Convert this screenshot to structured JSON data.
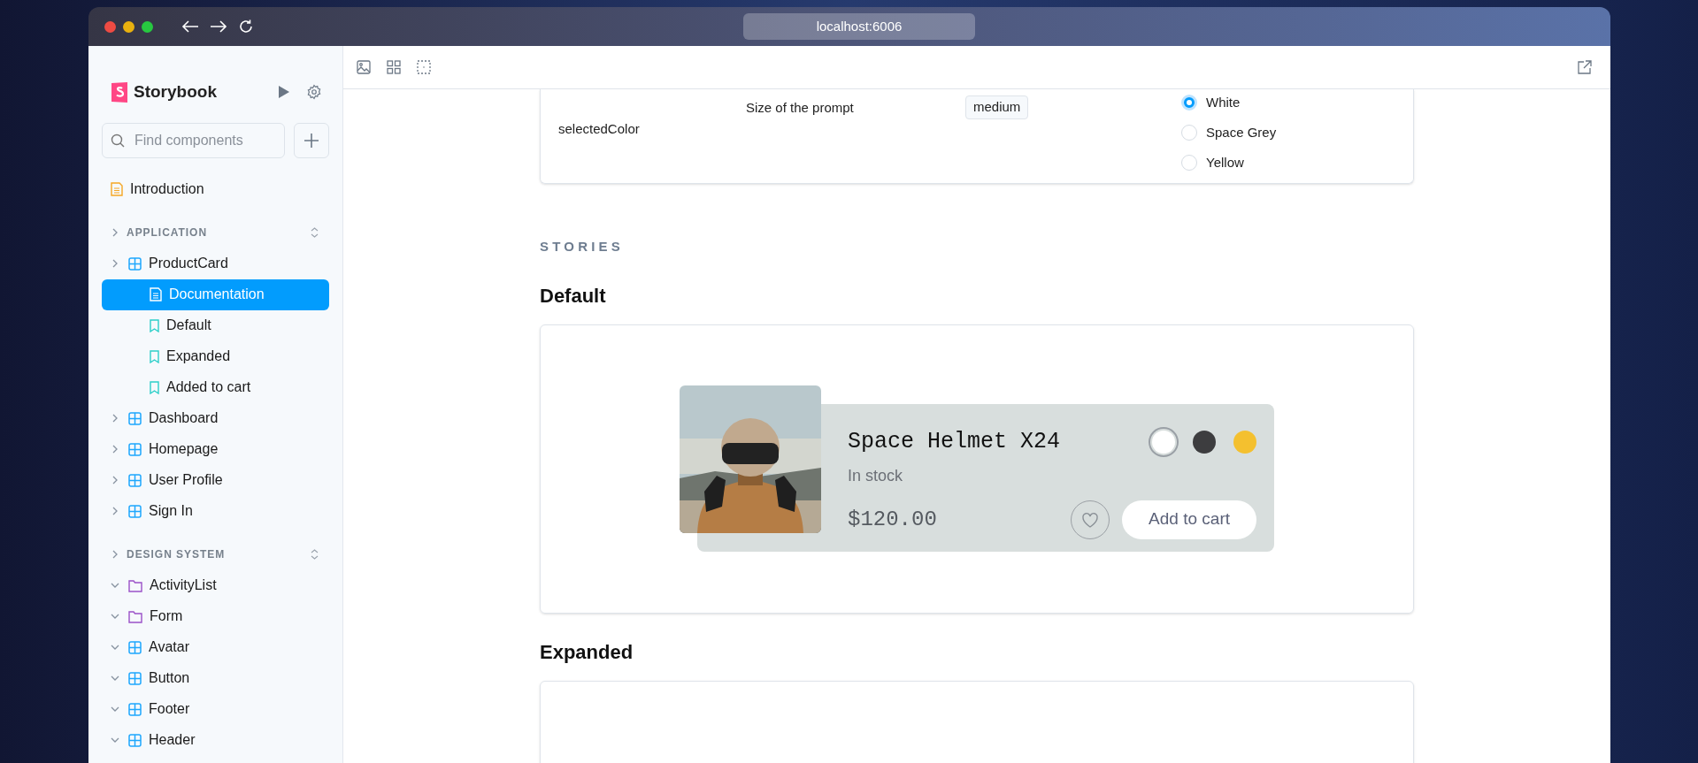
{
  "browser": {
    "address": "localhost:6006"
  },
  "sidebar": {
    "title": "Storybook",
    "search": {
      "placeholder": "Find components"
    },
    "items": [
      {
        "kind": "docs",
        "label": "Introduction",
        "selected": false
      },
      {
        "kind": "section",
        "label": "APPLICATION",
        "expanded": false,
        "children": [
          {
            "kind": "component",
            "label": "ProductCard",
            "expanded": false,
            "selected": false,
            "children": [
              {
                "kind": "page",
                "label": "Documentation",
                "selected": true
              },
              {
                "kind": "story",
                "label": "Default",
                "selected": false
              },
              {
                "kind": "story",
                "label": "Expanded",
                "selected": false
              },
              {
                "kind": "story",
                "label": "Added to cart",
                "selected": false
              }
            ]
          },
          {
            "kind": "component",
            "label": "Dashboard",
            "expanded": false,
            "selected": false
          },
          {
            "kind": "component",
            "label": "Homepage",
            "expanded": false,
            "selected": false
          },
          {
            "kind": "component",
            "label": "User Profile",
            "expanded": false,
            "selected": false
          },
          {
            "kind": "component",
            "label": "Sign In",
            "expanded": false,
            "selected": false
          }
        ]
      },
      {
        "kind": "section",
        "label": "DESIGN SYSTEM",
        "expanded": false,
        "children": [
          {
            "kind": "folder",
            "label": "ActivityList",
            "expanded": true,
            "selected": false
          },
          {
            "kind": "folder",
            "label": "Form",
            "expanded": true,
            "selected": false
          },
          {
            "kind": "component",
            "label": "Avatar",
            "expanded": true,
            "selected": false
          },
          {
            "kind": "component",
            "label": "Button",
            "expanded": true,
            "selected": false
          },
          {
            "kind": "component",
            "label": "Footer",
            "expanded": true,
            "selected": false
          },
          {
            "kind": "component",
            "label": "Header",
            "expanded": true,
            "selected": false
          }
        ]
      }
    ]
  },
  "args_table": {
    "description": "Size of the prompt",
    "default": "medium",
    "name": "selectedColor",
    "options": [
      {
        "label": "White",
        "selected": true
      },
      {
        "label": "Space Grey",
        "selected": false
      },
      {
        "label": "Yellow",
        "selected": false
      }
    ]
  },
  "stories_heading": "STORIES",
  "stories": [
    {
      "title": "Default",
      "card": {
        "kind": "picture",
        "name": "Space Helmet X24",
        "stock": "In stock",
        "price": "$120.00",
        "button": "Add to cart",
        "swatches": [
          {
            "color": "#ffffff",
            "selected": true
          },
          {
            "color": "#3d3d3f",
            "selected": false
          },
          {
            "color": "#f4c02f",
            "selected": false
          }
        ]
      }
    },
    {
      "title": "Expanded"
    }
  ]
}
